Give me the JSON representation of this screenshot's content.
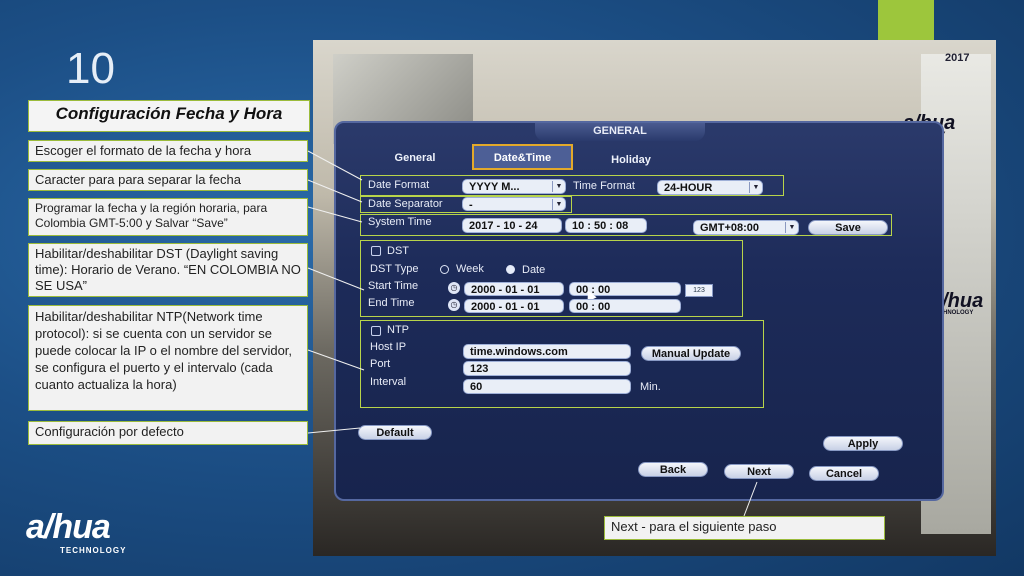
{
  "slide": {
    "number": "10",
    "title": "Configuración Fecha  y Hora"
  },
  "callouts": [
    "Escoger el formato de la fecha y hora",
    "Caracter para para separar la fecha",
    "Programar la fecha y la región horaria, para Colombia GMT-5:00 y Salvar “Save”",
    "Habilitar/deshabilitar DST (Daylight saving time): Horario de Verano. “EN COLOMBIA NO SE USA”",
    "Habilitar/deshabilitar NTP(Network time protocol): si se cuenta con un servidor se puede colocar la IP o el nombre del servidor, se configura el puerto y el intervalo (cada cuanto actualiza la hora)",
    "Configuración por defecto",
    "Next - para el siguiente paso"
  ],
  "brand": {
    "logo_text": "a/hua",
    "logo_sub": "TECHNOLOGY",
    "accent_color": "#9dc63c"
  },
  "camera": {
    "timestamp": "2017"
  },
  "dialog": {
    "title": "GENERAL",
    "tabs": [
      "General",
      "Date&Time",
      "Holiday"
    ],
    "active_tab": "Date&Time",
    "date_format_label": "Date Format",
    "date_format_value": "YYYY M...",
    "time_format_label": "Time Format",
    "time_format_value": "24-HOUR",
    "date_separator_label": "Date Separator",
    "date_separator_value": "-",
    "system_time_label": "System Time",
    "system_date_value": "2017  - 10 - 24",
    "system_time_value": "10 : 50 : 08",
    "timezone_value": "GMT+08:00",
    "save_label": "Save",
    "dst": {
      "label": "DST",
      "type_label": "DST Type",
      "week_label": "Week",
      "date_label": "Date",
      "start_label": "Start Time",
      "start_date": "2000  - 01 - 01",
      "start_time": "00 : 00",
      "end_label": "End Time",
      "end_date": "2000  - 01 - 01",
      "end_time": "00 : 00",
      "tooltip": "123"
    },
    "ntp": {
      "label": "NTP",
      "host_label": "Host IP",
      "host_value": "time.windows.com",
      "manual_update_label": "Manual Update",
      "port_label": "Port",
      "port_value": "123",
      "interval_label": "Interval",
      "interval_value": "60",
      "interval_unit": "Min."
    },
    "default_label": "Default",
    "apply_label": "Apply",
    "back_label": "Back",
    "next_label": "Next",
    "cancel_label": "Cancel"
  },
  "icons": [
    "clock-icon",
    "dropdown-caret-icon",
    "mouse-cursor-icon"
  ]
}
